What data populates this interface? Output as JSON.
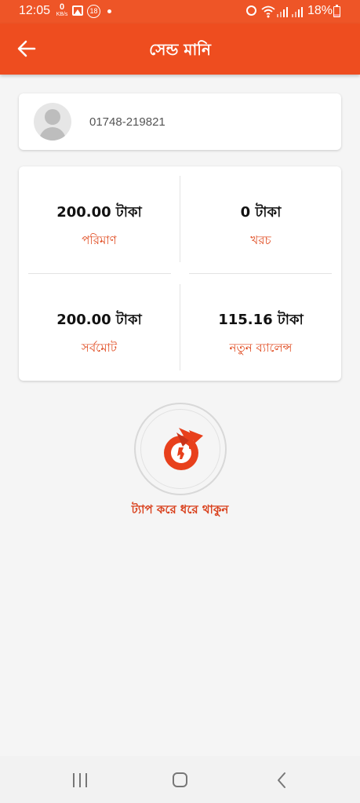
{
  "status_bar": {
    "time": "12:05",
    "net_speed": "0",
    "net_unit": "KB/s",
    "notif_count": "18",
    "battery": "18%"
  },
  "header": {
    "title": "সেন্ড মানি"
  },
  "recipient": {
    "phone": "01748-219821"
  },
  "summary": {
    "amount_value": "200.00 টাকা",
    "amount_label": "পরিমাণ",
    "charge_value": "0 টাকা",
    "charge_label": "খরচ",
    "total_value": "200.00 টাকা",
    "total_label": "সর্বমোট",
    "new_balance_value": "115.16 টাকা",
    "new_balance_label": "নতুন ব্যালেন্স"
  },
  "action": {
    "tap_text": "ট্যাপ করে ধরে থাকুন"
  },
  "colors": {
    "primary": "#ee4d1f",
    "label": "#e04a1f"
  }
}
